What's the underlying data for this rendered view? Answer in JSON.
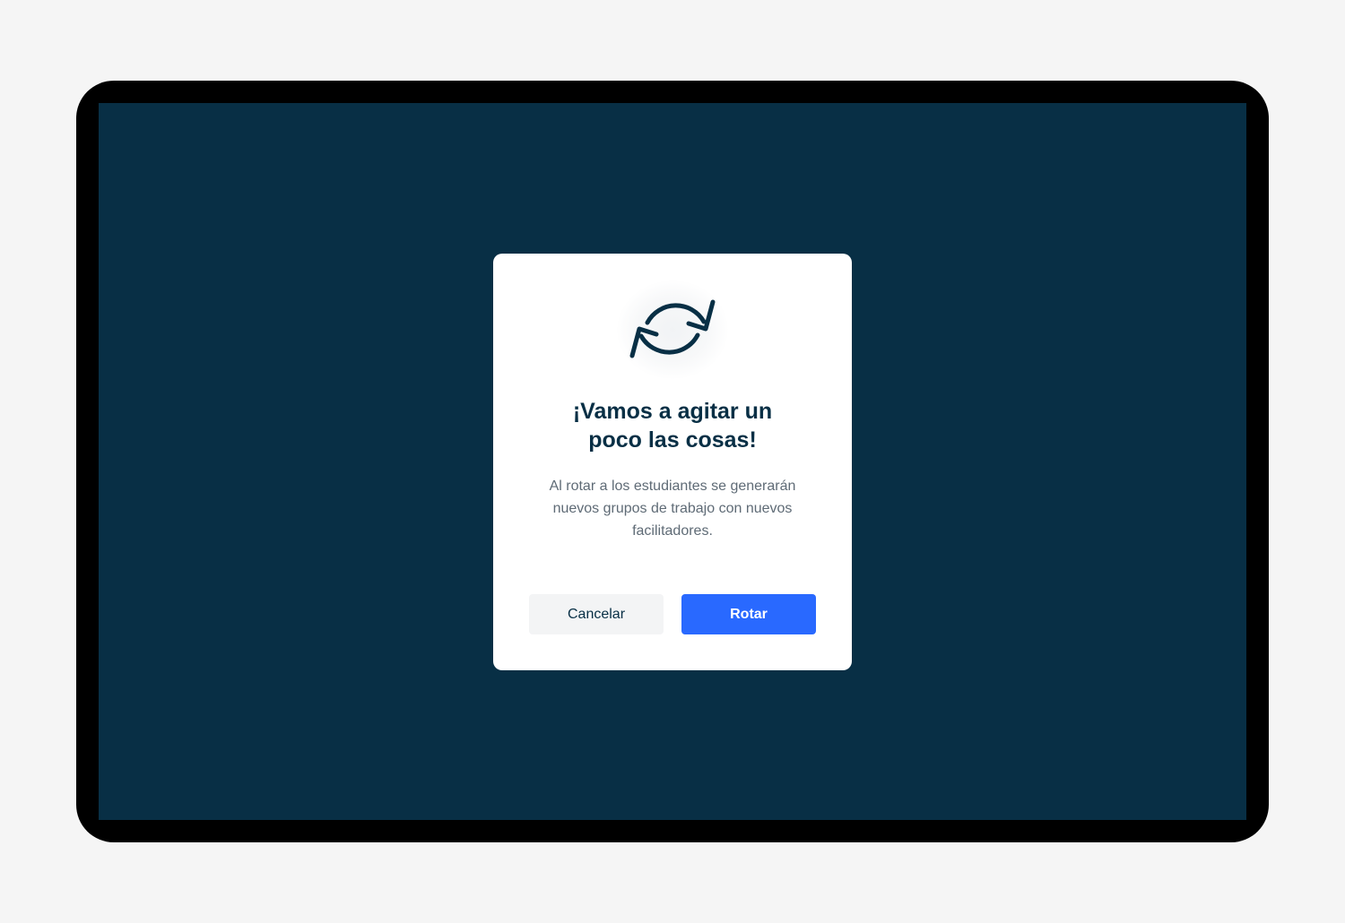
{
  "dialog": {
    "icon": "rotate-arrows-icon",
    "title_lines": [
      "¡Vamos a agitar un",
      "poco las cosas!"
    ],
    "body_lines": [
      "Al rotar a los estudiantes se generarán",
      "nuevos grupos de trabajo con nuevos",
      "facilitadores."
    ],
    "cancel_label": "Cancelar",
    "confirm_label": "Rotar"
  },
  "colors": {
    "page_background": "#f5f5f5",
    "device_frame": "#000000",
    "screen_background": "#082f45",
    "dialog_background": "#ffffff",
    "title_text": "#082f45",
    "body_text": "#5f6b76",
    "cancel_background": "#f3f4f5",
    "primary_button": "#2969ff",
    "icon_stroke": "#082f45"
  }
}
